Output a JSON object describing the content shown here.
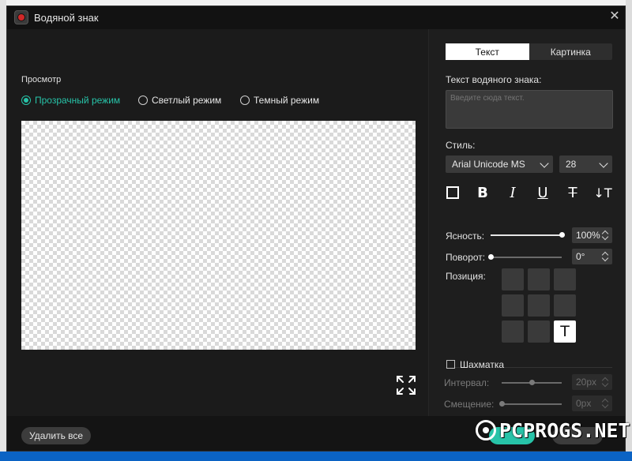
{
  "window": {
    "title": "Водяной знак",
    "close_glyph": "✕"
  },
  "preview": {
    "label": "Просмотр",
    "modes": [
      {
        "label": "Прозрачный режим",
        "selected": true
      },
      {
        "label": "Светлый режим",
        "selected": false
      },
      {
        "label": "Темный режим",
        "selected": false
      }
    ]
  },
  "tabs": [
    {
      "label": "Текст",
      "active": true
    },
    {
      "label": "Картинка",
      "active": false
    }
  ],
  "watermark_text": {
    "label": "Текст водяного знака:",
    "placeholder": "Введите сюда текст."
  },
  "style": {
    "label": "Стиль:",
    "font": "Arial Unicode MS",
    "size": "28",
    "format_buttons": [
      "□",
      "B",
      "I",
      "U",
      "T",
      "↓T"
    ]
  },
  "opacity": {
    "label": "Ясность:",
    "value": "100%",
    "level": 1.0
  },
  "rotation": {
    "label": "Поворот:",
    "value": "0°",
    "level": 0.0
  },
  "position": {
    "label": "Позиция:",
    "selected_glyph": "T",
    "selected": "bottom-right"
  },
  "tile": {
    "label": "Шахматка",
    "checked": false,
    "interval": {
      "label": "Интервал:",
      "value": "20px"
    },
    "offset": {
      "label": "Смещение:",
      "value": "0px"
    }
  },
  "footer": {
    "delete_all": "Удалить все"
  },
  "overlay_watermark": "PCPROGS.NET",
  "colors": {
    "accent": "#27c3a8",
    "dialog_bg": "#1b1b1b",
    "panel_bg": "#1e1e1e"
  }
}
